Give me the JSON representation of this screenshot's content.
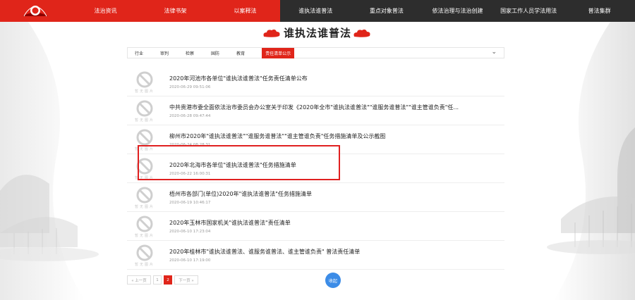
{
  "nav": {
    "red_items": [
      "法治资讯",
      "法律书架",
      "以案释法"
    ],
    "dark_items": [
      "谁执法谁普法",
      "重点对象普法",
      "依法治理与法治创建",
      "国家工作人员学法用法",
      "普法集群"
    ]
  },
  "section": {
    "title": "谁执法谁普法"
  },
  "tabs": {
    "items": [
      "行业",
      "审判",
      "检察",
      "国防",
      "教育"
    ],
    "active": "责任清单公示"
  },
  "thumb_caption": "暂无图片",
  "list": [
    {
      "title": "2020年河池市各单位\"谁执法谁普法\"任务责任清单公布",
      "date": "2020-06-29 09:51:06"
    },
    {
      "title": "中共贵港市委全面依法治市委员会办公室关于印发《2020年全市\"谁执法谁普法\"\"谁服务谁普法\"\"谁主管谁负责\"任...",
      "date": "2020-06-28 09:47:44"
    },
    {
      "title": "柳州市2020年\"谁执法谁普法\"\"谁服务谁普法\"\"谁主管谁负责\"任务措施清单及公示截图",
      "date": "2020-06-24 08:28:31"
    },
    {
      "title": "2020年北海市各单位\"谁执法谁普法\"任务措施清单",
      "date": "2020-06-22 16:00:31"
    },
    {
      "title": "梧州市各部门(单位)2020年\"谁执法谁普法\"任务措施清单",
      "date": "2020-06-19 10:46:17"
    },
    {
      "title": "2020年玉林市国家机关\"谁执法谁普法\"责任清单",
      "date": "2020-06-10 17:23:04"
    },
    {
      "title": "2020年桂林市\"谁执法谁普法、谁服务谁普法、谁主管谁负责\" 普法责任清单",
      "date": "2020-06-10 17:19:00"
    }
  ],
  "pager": {
    "prev": "« 上一页",
    "page1": "1",
    "page2": "2",
    "next": "下一页 »"
  },
  "collapse": "收起",
  "colors": {
    "brand_red": "#e0251a",
    "nav_dark": "#2d2d2d",
    "button_blue": "#3c8ce7",
    "highlight": "#e02020"
  }
}
